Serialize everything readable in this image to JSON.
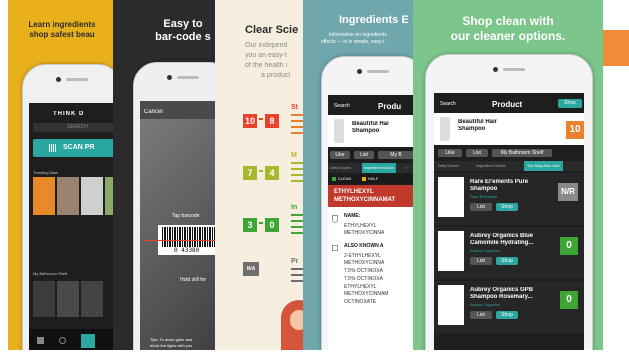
{
  "panel1": {
    "caption_line1": "Learn ingredients",
    "caption_line2": "shop safest beau",
    "app_title": "THINK D",
    "search_placeholder": "SEARCH",
    "scan_label": "SCAN PR",
    "trending_title": "Trending Now",
    "shelf_title": "My Bathroom Shelf"
  },
  "panel2": {
    "caption_line1": "Easy to",
    "caption_line2": "bar-code s",
    "cancel_label": "Cancel",
    "tap_hint": "Tap barcode",
    "barcode_digits": "0 43380",
    "hold_hint": "Hold still for",
    "tips_line1": "Tips: To avoid glare and",
    "tips_line2": "block the lights with you"
  },
  "panel3": {
    "caption": "Clear Scie",
    "intro_line1": "Our independ",
    "intro_line2": "you an easy-t",
    "intro_line3": "of the health i",
    "intro_line4": "a product",
    "ranges": [
      {
        "low": "10",
        "high": "8",
        "text": "St"
      },
      {
        "low": "7",
        "high": "4",
        "text": "M"
      },
      {
        "low": "3",
        "high": "0",
        "text": "In"
      }
    ],
    "na_label": "N/A",
    "na_text": "Pr"
  },
  "panel4": {
    "caption": "Ingredients E",
    "intro_line1": "Information on ingredients",
    "intro_line2": "effects — is in simple, easy-t",
    "back_label": "Search",
    "header_title": "Produ",
    "product_name_line1": "Beautiful Hai",
    "product_name_line2": "Shampoo",
    "like_label": "Like",
    "list_label": "List",
    "myb_label": "My B",
    "tab1": "Dirty Dozen",
    "tab2": "Ingredient Guide",
    "tab3": "I",
    "legend1": "CLEAN",
    "legend2": "HALF",
    "ingredient_title": "ETHYLHEXYL METHOXYCINNAMAT",
    "name_label": "NAME:",
    "name_value_line1": "ETHYLHEXYL",
    "name_value_line2": "METHOXYCINNA",
    "aka_label": "ALSO KNOWN A",
    "aka_lines": [
      "2-ETHYLHEXYL",
      "METHOXYCINNA",
      "7.5% OCTINOXA",
      "7.5% OCTINOXA",
      "ETHYLHEXYL",
      "METHOXYCINNAM",
      "OCTINOXATE"
    ]
  },
  "panel5": {
    "caption_line1": "Shop clean with",
    "caption_line2": "our cleaner options.",
    "back_label": "Search",
    "header_title": "Product",
    "shop_label": "Shop",
    "product_name_line1": "Beautiful Hair",
    "product_name_line2": "Shampoo",
    "product_score": "10",
    "like_label": "Like",
    "list_label": "List",
    "shelf_label": "My Bathroom Shelf",
    "tab1": "Dirty Dozen",
    "tab2": "Ingredient Guide",
    "tab3": "You May Also Like",
    "alternatives": [
      {
        "name_line1": "Rare El'ements Pure",
        "name_line2": "Shampoo",
        "brand": "Rare El'ements",
        "score": "N/R",
        "score_color": "#8a8a8a"
      },
      {
        "name_line1": "Aubrey Organics Blue",
        "name_line2": "Camomile Hydrating...",
        "brand": "Aubrey Organics",
        "score": "0",
        "score_color": "#3fa535"
      },
      {
        "name_line1": "Aubrey Organics GPB",
        "name_line2": "Shampoo Rosemary...",
        "brand": "Aubrey Organics",
        "score": "0",
        "score_color": "#3fa535"
      }
    ],
    "list_btn": "List",
    "shop_btn": "Shop"
  },
  "colors": {
    "red_score": "#e8412c",
    "orange_score": "#e8812c",
    "green_score": "#3fa535",
    "teal": "#2aa7a0",
    "brand_green": "#3fa535",
    "panel1_bg": "#e8b11c",
    "panel2_bg": "#2b2b2b",
    "panel3_bg": "#f6efe0",
    "panel4_bg": "#6fa7ad",
    "panel5_bg": "#7cc68c"
  }
}
